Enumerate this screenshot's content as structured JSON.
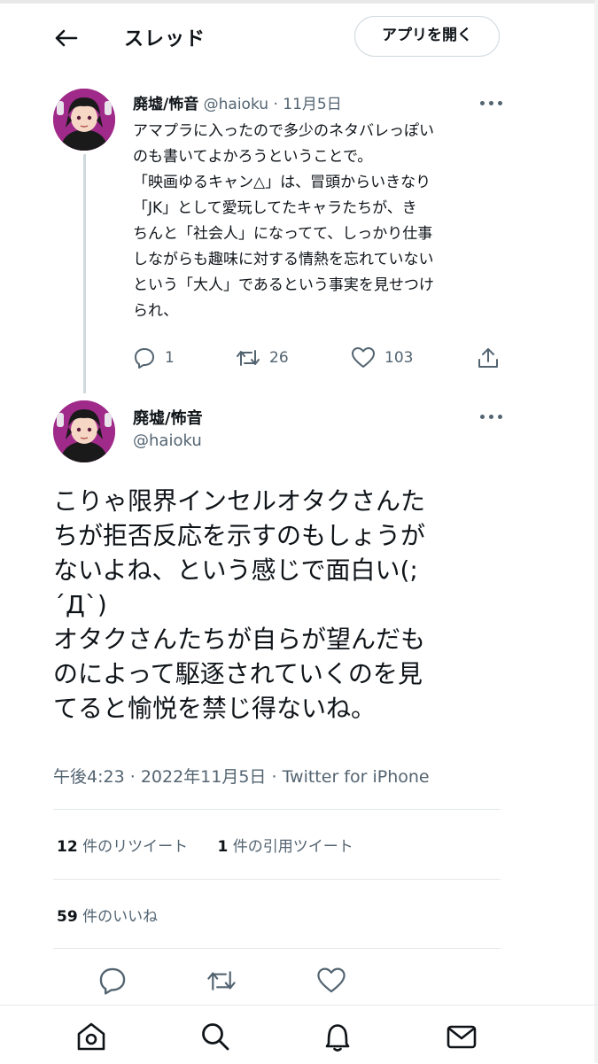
{
  "header": {
    "title": "スレッド",
    "open_app_label": "アプリを開く"
  },
  "parent_tweet": {
    "display_name": "廃墟/怖音",
    "handle": "@haioku",
    "separator": "·",
    "date": "11月5日",
    "lines": [
      "アマプラに入ったので多少のネタバレっぽい",
      "のも書いてよかろうということで。",
      "「映画ゆるキャン△」は、冒頭からいきなり",
      "「JK」として愛玩してたキャラたちが、き",
      "ちんと「社会人」になってて、しっかり仕事",
      "しながらも趣味に対する情熱を忘れていない",
      "という「大人」であるという事実を見せつけ",
      "られ、"
    ],
    "reply_count": "1",
    "retweet_count": "26",
    "like_count": "103"
  },
  "main_tweet": {
    "display_name": "廃墟/怖音",
    "handle": "@haioku",
    "lines": [
      "こりゃ限界インセルオタクさんた",
      "ちが拒否反応を示すのもしょうが",
      "ないよね、という感じで面白い(;",
      "´Д`)",
      "オタクさんたちが自らが望んだも",
      "のによって駆逐されていくのを見",
      "てると愉悦を禁じ得ないね。"
    ],
    "time": "午後4:23",
    "meta_sep": "·",
    "date": "2022年11月5日",
    "source": "Twitter for iPhone"
  },
  "stats": {
    "retweets_count": "12",
    "retweets_label": "件のリツイート",
    "quotes_count": "1",
    "quotes_label": "件の引用ツイート",
    "likes_count": "59",
    "likes_label": "件のいいね"
  },
  "colors": {
    "text": "#0f1419",
    "secondary": "#536471",
    "border": "#cfd9de",
    "divider": "#e4e8eb",
    "avatar_bg": "#a02a8a"
  },
  "icons": {
    "back": "arrow-left-icon",
    "more": "more-horizontal-icon",
    "reply": "reply-icon",
    "retweet": "retweet-icon",
    "like": "heart-icon",
    "share": "share-icon",
    "nav": [
      "home-icon",
      "search-icon",
      "notifications-icon",
      "messages-icon"
    ]
  }
}
